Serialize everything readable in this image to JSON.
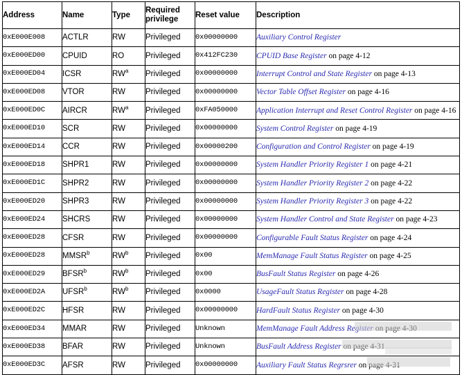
{
  "table": {
    "headers": [
      "Address",
      "Name",
      "Type",
      "Required privilege",
      "Reset value",
      "Description"
    ],
    "rows": [
      {
        "address": "0xE000E008",
        "name": "ACTLR",
        "type": "RW",
        "type_note": "",
        "privilege": "Privileged",
        "reset": "0x00000000",
        "desc_link": "Auxiliary Control Register",
        "desc_tail": ""
      },
      {
        "address": "0xE000ED00",
        "name": "CPUID",
        "type": "RO",
        "type_note": "",
        "privilege": "Privileged",
        "reset": "0x412FC230",
        "desc_link": "CPUID Base Register",
        "desc_tail": " on page 4-12"
      },
      {
        "address": "0xE000ED04",
        "name": "ICSR",
        "type": "RW",
        "type_note": "a",
        "privilege": "Privileged",
        "reset": "0x00000000",
        "desc_link": "Interrupt Control and State Register",
        "desc_tail": " on page 4-13"
      },
      {
        "address": "0xE000ED08",
        "name": "VTOR",
        "type": "RW",
        "type_note": "",
        "privilege": "Privileged",
        "reset": "0x00000000",
        "desc_link": "Vector Table Offset Register",
        "desc_tail": " on page 4-16"
      },
      {
        "address": "0xE000ED0C",
        "name": "AIRCR",
        "type": "RW",
        "type_note": "a",
        "privilege": "Privileged",
        "reset": "0xFA050000",
        "desc_link": "Application Interrupt and Reset Control Register",
        "desc_tail": " on page 4-16"
      },
      {
        "address": "0xE000ED10",
        "name": "SCR",
        "type": "RW",
        "type_note": "",
        "privilege": "Privileged",
        "reset": "0x00000000",
        "desc_link": "System Control Register",
        "desc_tail": " on page 4-19"
      },
      {
        "address": "0xE000ED14",
        "name": "CCR",
        "type": "RW",
        "type_note": "",
        "privilege": "Privileged",
        "reset": "0x00000200",
        "desc_link": "Configuration and Control Register",
        "desc_tail": " on page 4-19"
      },
      {
        "address": "0xE000ED18",
        "name": "SHPR1",
        "type": "RW",
        "type_note": "",
        "privilege": "Privileged",
        "reset": "0x00000000",
        "desc_link": "System Handler Priority Register 1",
        "desc_tail": " on page 4-21"
      },
      {
        "address": "0xE000ED1C",
        "name": "SHPR2",
        "type": "RW",
        "type_note": "",
        "privilege": "Privileged",
        "reset": "0x00000000",
        "desc_link": "System Handler Priority Register 2",
        "desc_tail": " on page 4-22"
      },
      {
        "address": "0xE000ED20",
        "name": "SHPR3",
        "type": "RW",
        "type_note": "",
        "privilege": "Privileged",
        "reset": "0x00000000",
        "desc_link": "System Handler Priority Register 3",
        "desc_tail": " on page 4-22"
      },
      {
        "address": "0xE000ED24",
        "name": "SHCRS",
        "type": "RW",
        "type_note": "",
        "privilege": "Privileged",
        "reset": "0x00000000",
        "desc_link": "System Handler Control and State Register",
        "desc_tail": " on page 4-23"
      },
      {
        "address": "0xE000ED28",
        "name": "CFSR",
        "type": "RW",
        "type_note": "",
        "privilege": "Privileged",
        "reset": "0x00000000",
        "desc_link": "Configurable Fault Status Register",
        "desc_tail": " on page 4-24"
      },
      {
        "address": "0xE000ED28",
        "name": "MMSR",
        "type": "RW",
        "type_note": "b",
        "privilege": "Privileged",
        "reset": "0x00",
        "desc_link": "MemManage Fault Status Register",
        "desc_tail": " on page 4-25"
      },
      {
        "address": "0xE000ED29",
        "name": "BFSR",
        "type": "RW",
        "type_note": "b",
        "privilege": "Privileged",
        "reset": "0x00",
        "desc_link": "BusFault Status Register",
        "desc_tail": " on page 4-26"
      },
      {
        "address": "0xE000ED2A",
        "name": "UFSR",
        "type": "RW",
        "type_note": "b",
        "privilege": "Privileged",
        "reset": "0x0000",
        "desc_link": "UsageFault Status Register",
        "desc_tail": " on page 4-28"
      },
      {
        "address": "0xE000ED2C",
        "name": "HFSR",
        "type": "RW",
        "type_note": "",
        "privilege": "Privileged",
        "reset": "0x00000000",
        "desc_link": "HardFault Status Register",
        "desc_tail": " on page 4-30"
      },
      {
        "address": "0xE000ED34",
        "name": "MMAR",
        "type": "RW",
        "type_note": "",
        "privilege": "Privileged",
        "reset": "Unknown",
        "desc_link": "MemManage Fault Address Register",
        "desc_tail": " on page 4-30"
      },
      {
        "address": "0xE000ED38",
        "name": "BFAR",
        "type": "RW",
        "type_note": "",
        "privilege": "Privileged",
        "reset": "Unknown",
        "desc_link": "BusFault Address Register",
        "desc_tail": " on page 4-31"
      },
      {
        "address": "0xE000ED3C",
        "name": "AFSR",
        "type": "RW",
        "type_note": "",
        "privilege": "Privileged",
        "reset": "0x00000000",
        "desc_link": "Auxiliary Fault Status Regrsrer",
        "desc_tail": " on page 4-31"
      }
    ]
  }
}
